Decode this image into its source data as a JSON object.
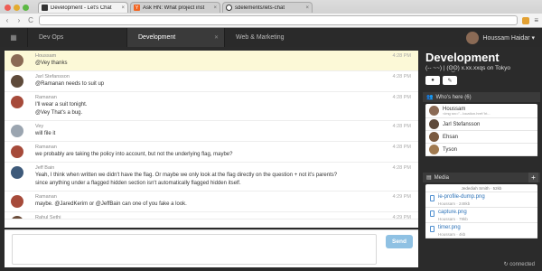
{
  "browser": {
    "tabs": [
      {
        "title": "Development - Let's Chat",
        "favicon": "chat",
        "active": true
      },
      {
        "title": "Ask HN: What project inst",
        "favicon": "hn",
        "active": false
      },
      {
        "title": "sdelements/lets-chat",
        "favicon": "github",
        "active": false
      }
    ]
  },
  "topbar": {
    "rooms": [
      {
        "label": "Dev Ops",
        "active": false
      },
      {
        "label": "Development",
        "active": true
      },
      {
        "label": "Web & Marketing",
        "active": false
      }
    ],
    "user_name": "Houssam Haidar ▾"
  },
  "messages": [
    {
      "author": "Houssam",
      "time": "4:28 PM",
      "lines": [
        "@Vey thanks"
      ],
      "highlight": true,
      "avatar_color": "#8a6a55"
    },
    {
      "author": "Jarl Stefansson",
      "time": "4:28 PM",
      "lines": [
        "@Ramanan needs to suit up"
      ],
      "avatar_color": "#5e4a3a"
    },
    {
      "author": "Ramanan",
      "time": "4:28 PM",
      "lines": [
        "I'll wear a suit tonight.",
        "@Vey That's a bug."
      ],
      "avatar_color": "#a64a3a"
    },
    {
      "author": "Vey",
      "time": "4:28 PM",
      "lines": [
        "will file it"
      ],
      "avatar_color": "#9ba5b0"
    },
    {
      "author": "Ramanan",
      "time": "4:28 PM",
      "lines": [
        "we probably are taking the policy into account, but not the underlying flag, maybe?"
      ],
      "avatar_color": "#a64a3a"
    },
    {
      "author": "Jeff Bain",
      "time": "4:28 PM",
      "lines": [
        "Yeah, I think when written we didn't have the flag. Or maybe we only look at the flag directly on the question + not it's parents?",
        "since anything under a flagged hidden section isn't automatically flagged hidden itself."
      ],
      "avatar_color": "#3e5a7a"
    },
    {
      "author": "Ramanan",
      "time": "4:29 PM",
      "lines": [
        "maybe. @JaredKerim or @JeffBain can one of you fake a look."
      ],
      "avatar_color": "#a64a3a"
    },
    {
      "author": "Rahul Sethi",
      "time": "4:29 PM",
      "lines": [],
      "avatar_color": "#6b4d3a"
    }
  ],
  "composer": {
    "placeholder": "",
    "send_label": "Send"
  },
  "sidebar": {
    "room_name": "Development",
    "room_topic": "(-- ~~) | (ʘ͜ʘ) x.xx.xxqs on Tokyo",
    "who_header": "Who's here (6)",
    "users": [
      {
        "name": "Houssam",
        "sub": "<img src=\"...location.href:'ht...",
        "avatar_color": "#8a6a55"
      },
      {
        "name": "Jarl Stefansson",
        "avatar_color": "#5e4a3a"
      },
      {
        "name": "Ehsan",
        "avatar_color": "#7a5a40"
      },
      {
        "name": "Tyson",
        "avatar_color": "#a07a50"
      }
    ],
    "media_header": "Media",
    "media_top": "Jedediah Smith · 52kb",
    "files": [
      {
        "name": "ie-profile-dump.png",
        "meta": "Houssam · 248kb"
      },
      {
        "name": "capture.png",
        "meta": "Houssam · 79kb"
      },
      {
        "name": "timer.png",
        "meta": "Houssam · 4kb"
      }
    ],
    "connected_label": "connected"
  }
}
